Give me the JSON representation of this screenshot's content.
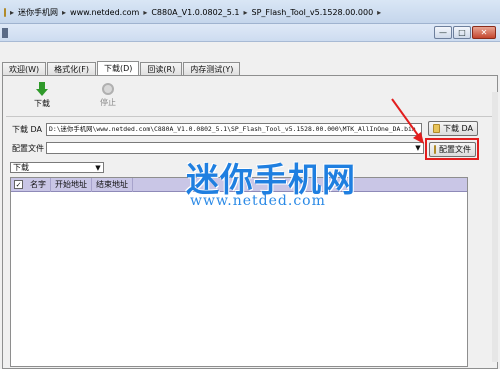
{
  "breadcrumb": {
    "items": [
      "迷你手机网",
      "www.netded.com",
      "C880A_V1.0.0802_5.1",
      "SP_Flash_Tool_v5.1528.00.000"
    ],
    "separator": "▸"
  },
  "window": {
    "minimize": "—",
    "maximize": "□",
    "close": "✕"
  },
  "tabs": [
    {
      "label": "欢迎(W)"
    },
    {
      "label": "格式化(F)"
    },
    {
      "label": "下载(D)"
    },
    {
      "label": "回读(R)"
    },
    {
      "label": "内存测试(Y)"
    }
  ],
  "toolbar": {
    "download_label": "下载",
    "stop_label": "停止"
  },
  "download_agent": {
    "label": "下载 DA",
    "path": "D:\\迷你手机网\\www.netded.com\\C880A_V1.0.0802_5.1\\SP_Flash_Tool_v5.1528.00.000\\MTK_AllInOne_DA.bin",
    "button_label": "下载 DA"
  },
  "scatter": {
    "label": "配置文件",
    "value": "",
    "button_label": "配置文件"
  },
  "mode": {
    "selected": "下载"
  },
  "table": {
    "columns": [
      "名字",
      "开始地址",
      "结束地址"
    ],
    "header_checkbox": "✓"
  },
  "watermark": {
    "title": "迷你手机网",
    "url": "www.netded.com"
  },
  "colors": {
    "callout": "#e21e1e",
    "watermark": "#1f7fe0",
    "table_header": "#c9c6e6"
  }
}
